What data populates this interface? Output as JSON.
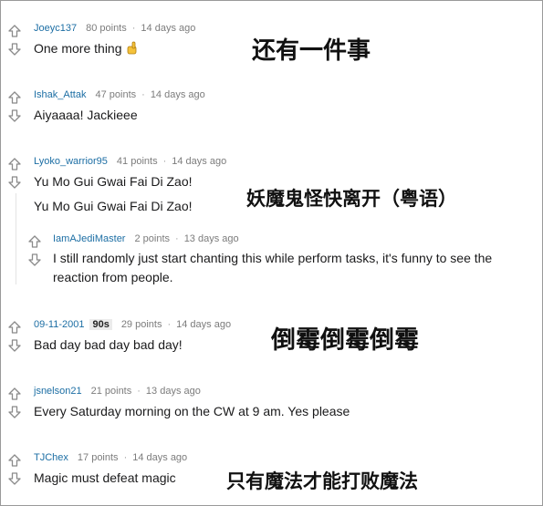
{
  "comments": [
    {
      "user": "Joeyc137",
      "points": "80 points",
      "age": "14 days ago",
      "text": "One more thing",
      "annotation": "还有一件事"
    },
    {
      "user": "Ishak_Attak",
      "points": "47 points",
      "age": "14 days ago",
      "text": "Aiyaaaa! Jackieee",
      "annotation": ""
    },
    {
      "user": "Lyoko_warrior95",
      "points": "41 points",
      "age": "14 days ago",
      "text": "Yu Mo Gui Gwai Fai Di Zao!",
      "text2": "Yu Mo Gui Gwai Fai Di Zao!",
      "annotation": "妖魔鬼怪快离开（粤语）",
      "reply": {
        "user": "IamAJediMaster",
        "points": "2 points",
        "age": "13 days ago",
        "text": "I still randomly just start chanting this while perform tasks, it's funny to see the reaction from people."
      }
    },
    {
      "user": "09-11-2001",
      "flair": "90s",
      "points": "29 points",
      "age": "14 days ago",
      "text": "Bad day bad day bad day!",
      "annotation": "倒霉倒霉倒霉"
    },
    {
      "user": "jsnelson21",
      "points": "21 points",
      "age": "13 days ago",
      "text": "Every Saturday morning on the CW at 9 am. Yes please",
      "annotation": ""
    },
    {
      "user": "TJChex",
      "points": "17 points",
      "age": "14 days ago",
      "text": "Magic must defeat magic",
      "annotation": "只有魔法才能打败魔法"
    }
  ],
  "icons": {
    "upvote": "upvote-arrow-icon",
    "downvote": "downvote-arrow-icon",
    "emoji": "pointing-hand-emoji"
  }
}
